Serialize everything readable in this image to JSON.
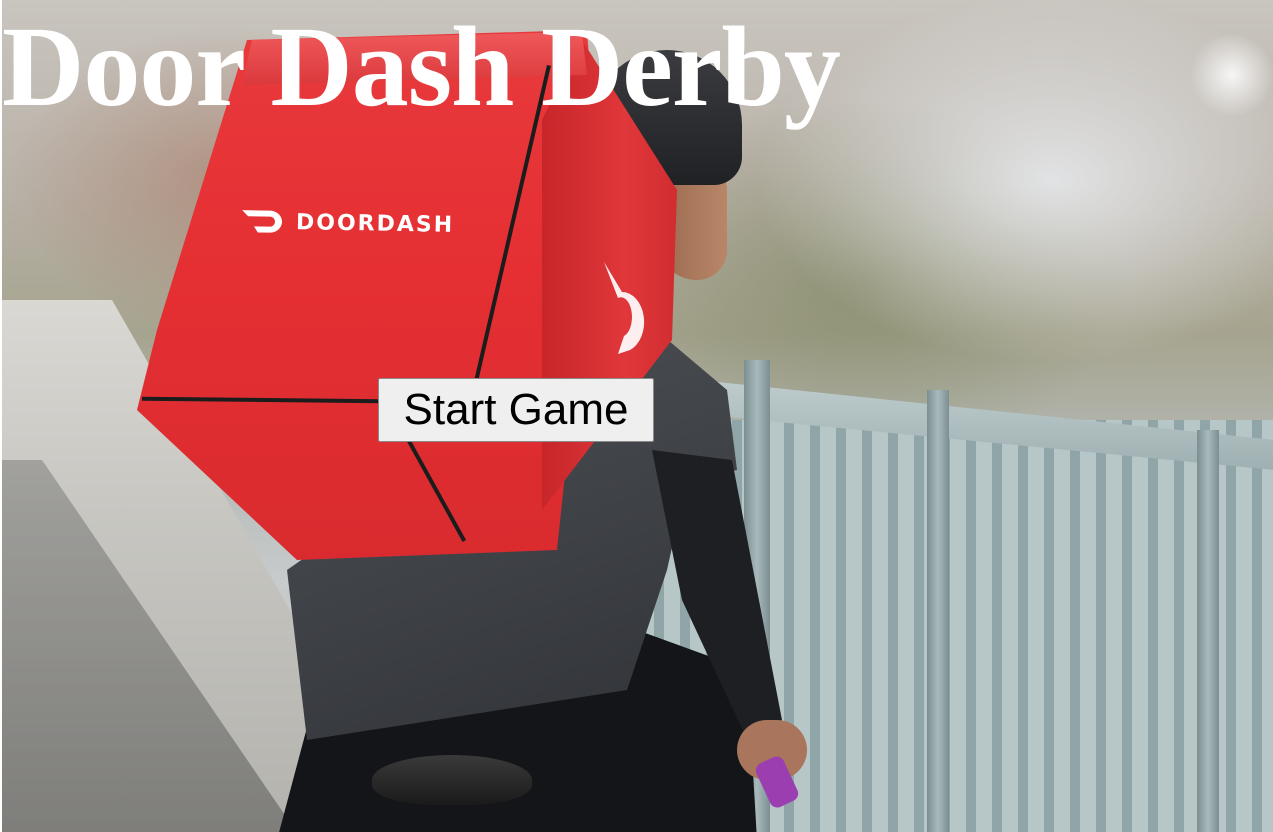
{
  "title": "Door Dash Derby",
  "start_button": {
    "label": "Start Game"
  },
  "background_photo": {
    "bag_brand_text": "DOORDASH",
    "logo_icon": "doordash-logo-icon",
    "colors": {
      "bag_red": "#e52f33",
      "title_text": "#ffffff",
      "button_bg": "#efefef"
    }
  }
}
